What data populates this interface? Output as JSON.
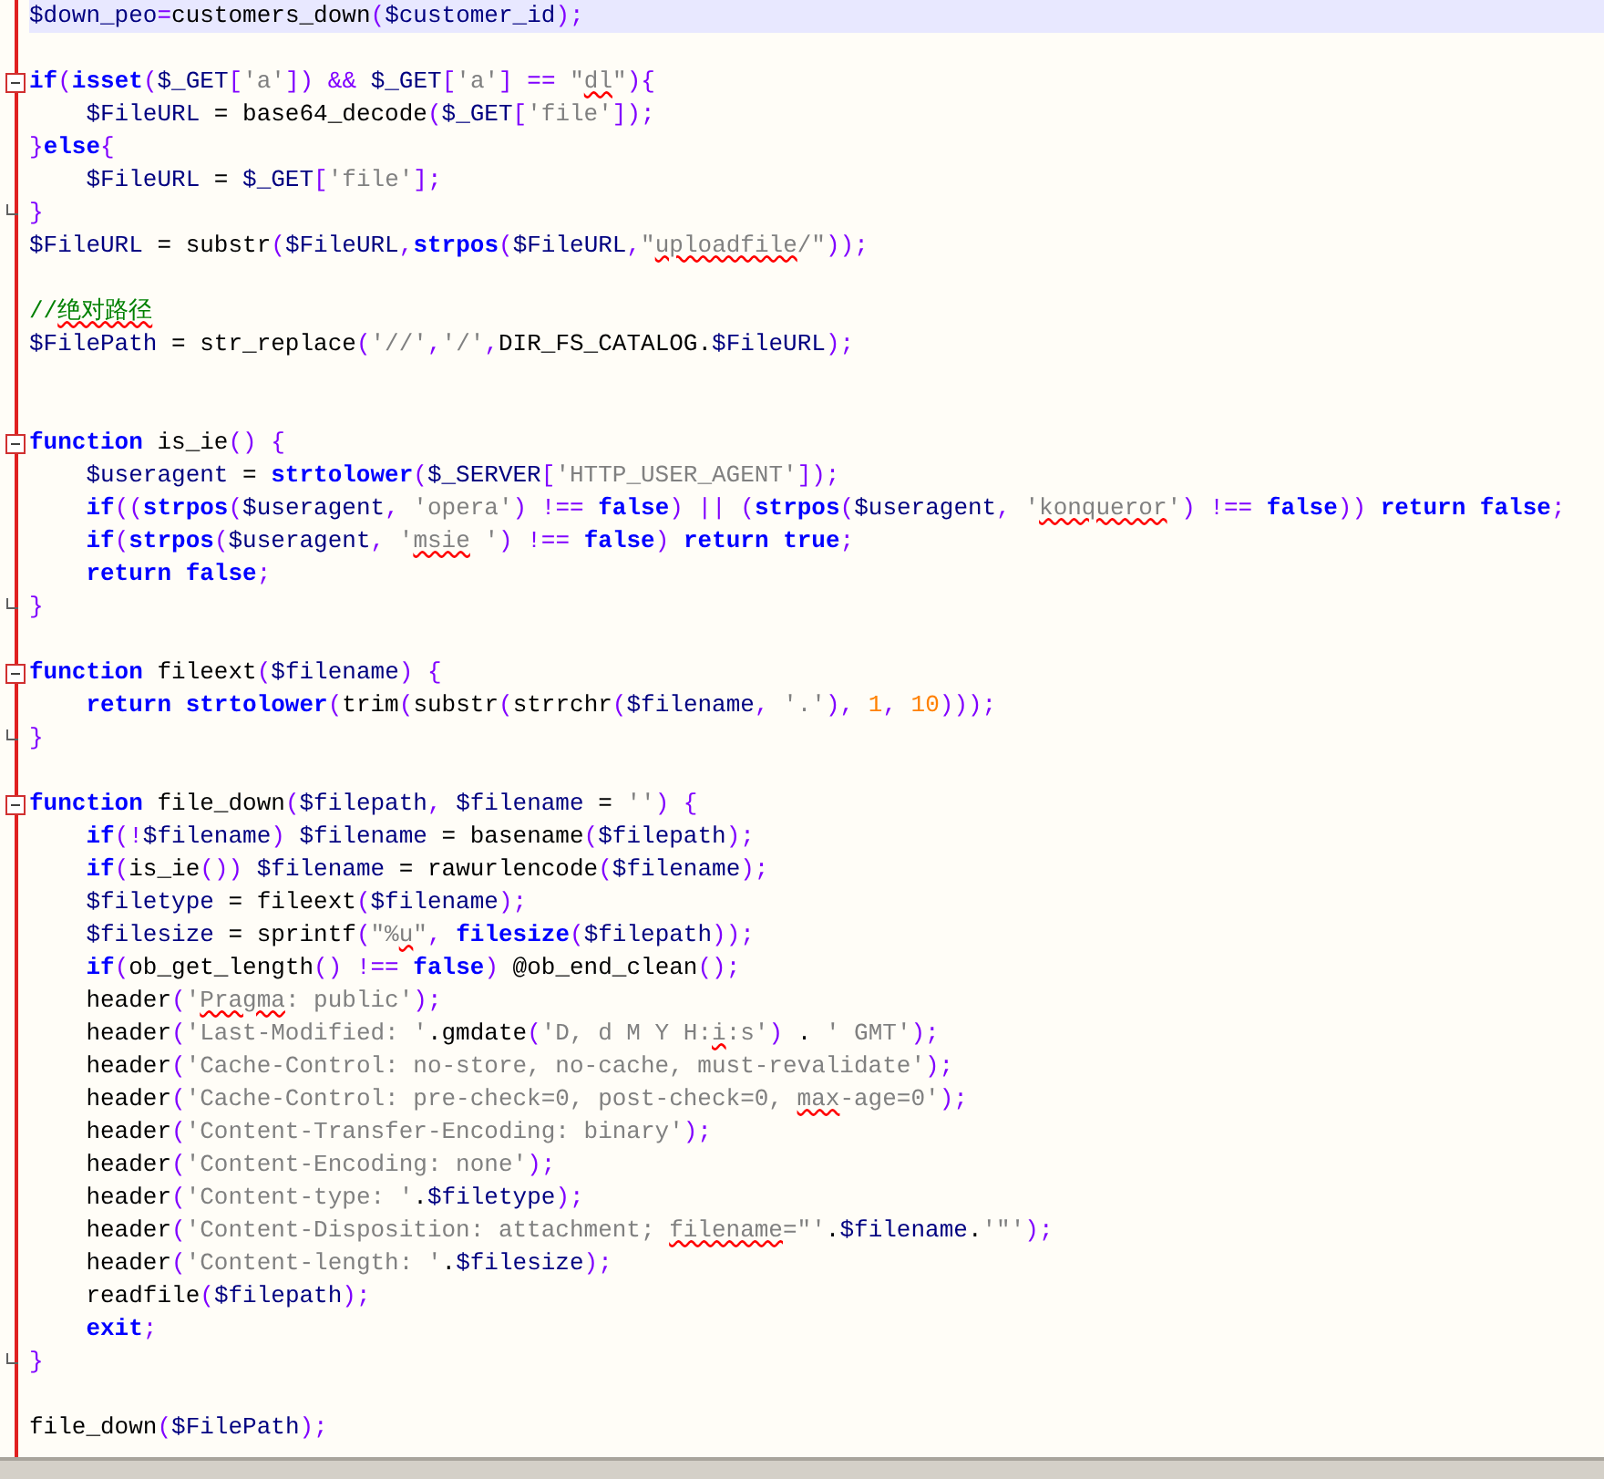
{
  "editor": {
    "lines": [
      {
        "kind": "code",
        "highlighted": true,
        "tokens": [
          {
            "kind": "var",
            "text": "$down_peo"
          },
          {
            "kind": "op",
            "text": "="
          },
          {
            "kind": "plain",
            "text": "customers_down"
          },
          {
            "kind": "punct",
            "text": "("
          },
          {
            "kind": "var",
            "text": "$customer_id"
          },
          {
            "kind": "punct",
            "text": ");"
          }
        ]
      },
      {
        "kind": "blank",
        "highlighted": false
      },
      {
        "kind": "fold-start",
        "highlighted": false,
        "tokens": [
          {
            "kind": "kw",
            "text": "if"
          },
          {
            "kind": "punct",
            "text": "("
          },
          {
            "kind": "kw",
            "text": "isset"
          },
          {
            "kind": "punct",
            "text": "("
          },
          {
            "kind": "var",
            "text": "$_GET"
          },
          {
            "kind": "punct",
            "text": "["
          },
          {
            "kind": "str",
            "text": "'a'"
          },
          {
            "kind": "punct",
            "text": "])"
          },
          {
            "kind": "op",
            "text": " && "
          },
          {
            "kind": "var",
            "text": "$_GET"
          },
          {
            "kind": "punct",
            "text": "["
          },
          {
            "kind": "str",
            "text": "'a'"
          },
          {
            "kind": "punct",
            "text": "]"
          },
          {
            "kind": "op",
            "text": " == "
          },
          {
            "kind": "str",
            "text": "\""
          },
          {
            "kind": "str-flagged",
            "text": "dl"
          },
          {
            "kind": "str",
            "text": "\""
          },
          {
            "kind": "punct",
            "text": "){"
          }
        ]
      },
      {
        "kind": "code",
        "highlighted": false,
        "tokens": [
          {
            "kind": "var",
            "text": "    $FileURL"
          },
          {
            "kind": "plain",
            "text": " = base64_decode"
          },
          {
            "kind": "punct",
            "text": "("
          },
          {
            "kind": "var",
            "text": "$_GET"
          },
          {
            "kind": "punct",
            "text": "["
          },
          {
            "kind": "str",
            "text": "'file'"
          },
          {
            "kind": "punct",
            "text": "]);"
          }
        ]
      },
      {
        "kind": "code",
        "highlighted": false,
        "tokens": [
          {
            "kind": "punct",
            "text": "}"
          },
          {
            "kind": "kw",
            "text": "else"
          },
          {
            "kind": "punct",
            "text": "{"
          }
        ]
      },
      {
        "kind": "code",
        "highlighted": false,
        "tokens": [
          {
            "kind": "var",
            "text": "    $FileURL"
          },
          {
            "kind": "plain",
            "text": " = "
          },
          {
            "kind": "var",
            "text": "$_GET"
          },
          {
            "kind": "punct",
            "text": "["
          },
          {
            "kind": "str",
            "text": "'file'"
          },
          {
            "kind": "punct",
            "text": "];"
          }
        ]
      },
      {
        "kind": "fold-end",
        "highlighted": false,
        "tokens": [
          {
            "kind": "punct",
            "text": "}"
          }
        ]
      },
      {
        "kind": "code",
        "highlighted": false,
        "tokens": [
          {
            "kind": "var",
            "text": "$FileURL"
          },
          {
            "kind": "plain",
            "text": " = substr"
          },
          {
            "kind": "punct",
            "text": "("
          },
          {
            "kind": "var",
            "text": "$FileURL"
          },
          {
            "kind": "punct",
            "text": ","
          },
          {
            "kind": "fn",
            "text": "strpos"
          },
          {
            "kind": "punct",
            "text": "("
          },
          {
            "kind": "var",
            "text": "$FileURL"
          },
          {
            "kind": "punct",
            "text": ","
          },
          {
            "kind": "str",
            "text": "\""
          },
          {
            "kind": "str-flagged",
            "text": "uploadfile"
          },
          {
            "kind": "str",
            "text": "/\""
          },
          {
            "kind": "punct",
            "text": "));"
          }
        ]
      },
      {
        "kind": "blank",
        "highlighted": false
      },
      {
        "kind": "code",
        "highlighted": false,
        "tokens": [
          {
            "kind": "comment",
            "text": "//"
          },
          {
            "kind": "comment-flagged",
            "text": "绝对路径"
          }
        ]
      },
      {
        "kind": "code",
        "highlighted": false,
        "tokens": [
          {
            "kind": "var",
            "text": "$FilePath"
          },
          {
            "kind": "plain",
            "text": " = str_replace"
          },
          {
            "kind": "punct",
            "text": "("
          },
          {
            "kind": "str",
            "text": "'//'"
          },
          {
            "kind": "punct",
            "text": ","
          },
          {
            "kind": "str",
            "text": "'/'"
          },
          {
            "kind": "punct",
            "text": ","
          },
          {
            "kind": "plain",
            "text": "DIR_FS_CATALOG."
          },
          {
            "kind": "var",
            "text": "$FileURL"
          },
          {
            "kind": "punct",
            "text": ");"
          }
        ]
      },
      {
        "kind": "blank",
        "highlighted": false
      },
      {
        "kind": "blank",
        "highlighted": false
      },
      {
        "kind": "fold-start",
        "highlighted": false,
        "tokens": [
          {
            "kind": "kw",
            "text": "function"
          },
          {
            "kind": "plain",
            "text": " is_ie"
          },
          {
            "kind": "punct",
            "text": "()"
          },
          {
            "kind": "punct",
            "text": " {"
          }
        ]
      },
      {
        "kind": "code",
        "highlighted": false,
        "tokens": [
          {
            "kind": "var",
            "text": "    $useragent"
          },
          {
            "kind": "plain",
            "text": " = "
          },
          {
            "kind": "fn",
            "text": "strtolower"
          },
          {
            "kind": "punct",
            "text": "("
          },
          {
            "kind": "var",
            "text": "$_SERVER"
          },
          {
            "kind": "punct",
            "text": "["
          },
          {
            "kind": "str",
            "text": "'HTTP_USER_AGENT'"
          },
          {
            "kind": "punct",
            "text": "]);"
          }
        ]
      },
      {
        "kind": "code",
        "highlighted": false,
        "tokens": [
          {
            "kind": "kw",
            "text": "    if"
          },
          {
            "kind": "punct",
            "text": "(("
          },
          {
            "kind": "fn",
            "text": "strpos"
          },
          {
            "kind": "punct",
            "text": "("
          },
          {
            "kind": "var",
            "text": "$useragent"
          },
          {
            "kind": "punct",
            "text": ", "
          },
          {
            "kind": "str",
            "text": "'opera'"
          },
          {
            "kind": "punct",
            "text": ")"
          },
          {
            "kind": "op",
            "text": " !== "
          },
          {
            "kind": "kw",
            "text": "false"
          },
          {
            "kind": "punct",
            "text": ")"
          },
          {
            "kind": "op",
            "text": " || "
          },
          {
            "kind": "punct",
            "text": "("
          },
          {
            "kind": "fn",
            "text": "strpos"
          },
          {
            "kind": "punct",
            "text": "("
          },
          {
            "kind": "var",
            "text": "$useragent"
          },
          {
            "kind": "punct",
            "text": ", "
          },
          {
            "kind": "str",
            "text": "'"
          },
          {
            "kind": "str-flagged",
            "text": "konqueror"
          },
          {
            "kind": "str",
            "text": "'"
          },
          {
            "kind": "punct",
            "text": ")"
          },
          {
            "kind": "op",
            "text": " !== "
          },
          {
            "kind": "kw",
            "text": "false"
          },
          {
            "kind": "punct",
            "text": "))"
          },
          {
            "kind": "kw",
            "text": " return false"
          },
          {
            "kind": "punct",
            "text": ";"
          }
        ]
      },
      {
        "kind": "code",
        "highlighted": false,
        "tokens": [
          {
            "kind": "kw",
            "text": "    if"
          },
          {
            "kind": "punct",
            "text": "("
          },
          {
            "kind": "fn",
            "text": "strpos"
          },
          {
            "kind": "punct",
            "text": "("
          },
          {
            "kind": "var",
            "text": "$useragent"
          },
          {
            "kind": "punct",
            "text": ", "
          },
          {
            "kind": "str",
            "text": "'"
          },
          {
            "kind": "str-flagged",
            "text": "msie"
          },
          {
            "kind": "str",
            "text": " '"
          },
          {
            "kind": "punct",
            "text": ")"
          },
          {
            "kind": "op",
            "text": " !== "
          },
          {
            "kind": "kw",
            "text": "false"
          },
          {
            "kind": "punct",
            "text": ")"
          },
          {
            "kind": "kw",
            "text": " return true"
          },
          {
            "kind": "punct",
            "text": ";"
          }
        ]
      },
      {
        "kind": "code",
        "highlighted": false,
        "tokens": [
          {
            "kind": "kw",
            "text": "    return false"
          },
          {
            "kind": "punct",
            "text": ";"
          }
        ]
      },
      {
        "kind": "fold-end",
        "highlighted": false,
        "tokens": [
          {
            "kind": "punct",
            "text": "}"
          }
        ]
      },
      {
        "kind": "blank",
        "highlighted": false
      },
      {
        "kind": "fold-start",
        "highlighted": false,
        "tokens": [
          {
            "kind": "kw",
            "text": "function"
          },
          {
            "kind": "plain",
            "text": " fileext"
          },
          {
            "kind": "punct",
            "text": "("
          },
          {
            "kind": "var",
            "text": "$filename"
          },
          {
            "kind": "punct",
            "text": ") {"
          }
        ]
      },
      {
        "kind": "code",
        "highlighted": false,
        "tokens": [
          {
            "kind": "kw",
            "text": "    return"
          },
          {
            "kind": "fn",
            "text": " strtolower"
          },
          {
            "kind": "punct",
            "text": "("
          },
          {
            "kind": "plain",
            "text": "trim"
          },
          {
            "kind": "punct",
            "text": "("
          },
          {
            "kind": "plain",
            "text": "substr"
          },
          {
            "kind": "punct",
            "text": "("
          },
          {
            "kind": "plain",
            "text": "strrchr"
          },
          {
            "kind": "punct",
            "text": "("
          },
          {
            "kind": "var",
            "text": "$filename"
          },
          {
            "kind": "punct",
            "text": ", "
          },
          {
            "kind": "str",
            "text": "'.'"
          },
          {
            "kind": "punct",
            "text": "),"
          },
          {
            "kind": "num",
            "text": " 1"
          },
          {
            "kind": "punct",
            "text": ","
          },
          {
            "kind": "num",
            "text": " 10"
          },
          {
            "kind": "punct",
            "text": ")));"
          }
        ]
      },
      {
        "kind": "fold-end",
        "highlighted": false,
        "tokens": [
          {
            "kind": "punct",
            "text": "}"
          }
        ]
      },
      {
        "kind": "blank",
        "highlighted": false
      },
      {
        "kind": "fold-start",
        "highlighted": false,
        "tokens": [
          {
            "kind": "kw",
            "text": "function"
          },
          {
            "kind": "plain",
            "text": " file_down"
          },
          {
            "kind": "punct",
            "text": "("
          },
          {
            "kind": "var",
            "text": "$filepath"
          },
          {
            "kind": "punct",
            "text": ", "
          },
          {
            "kind": "var",
            "text": "$filename"
          },
          {
            "kind": "plain",
            "text": " = "
          },
          {
            "kind": "str",
            "text": "''"
          },
          {
            "kind": "punct",
            "text": ") {"
          }
        ]
      },
      {
        "kind": "code",
        "highlighted": false,
        "tokens": [
          {
            "kind": "kw",
            "text": "    if"
          },
          {
            "kind": "punct",
            "text": "(!"
          },
          {
            "kind": "var",
            "text": "$filename"
          },
          {
            "kind": "punct",
            "text": ")"
          },
          {
            "kind": "var",
            "text": " $filename"
          },
          {
            "kind": "plain",
            "text": " = basename"
          },
          {
            "kind": "punct",
            "text": "("
          },
          {
            "kind": "var",
            "text": "$filepath"
          },
          {
            "kind": "punct",
            "text": ");"
          }
        ]
      },
      {
        "kind": "code",
        "highlighted": false,
        "tokens": [
          {
            "kind": "kw",
            "text": "    if"
          },
          {
            "kind": "punct",
            "text": "("
          },
          {
            "kind": "plain",
            "text": "is_ie"
          },
          {
            "kind": "punct",
            "text": "())"
          },
          {
            "kind": "var",
            "text": " $filename"
          },
          {
            "kind": "plain",
            "text": " = rawurlencode"
          },
          {
            "kind": "punct",
            "text": "("
          },
          {
            "kind": "var",
            "text": "$filename"
          },
          {
            "kind": "punct",
            "text": ");"
          }
        ]
      },
      {
        "kind": "code",
        "highlighted": false,
        "tokens": [
          {
            "kind": "var",
            "text": "    $filetype"
          },
          {
            "kind": "plain",
            "text": " = fileext"
          },
          {
            "kind": "punct",
            "text": "("
          },
          {
            "kind": "var",
            "text": "$filename"
          },
          {
            "kind": "punct",
            "text": ");"
          }
        ]
      },
      {
        "kind": "code",
        "highlighted": false,
        "tokens": [
          {
            "kind": "var",
            "text": "    $filesize"
          },
          {
            "kind": "plain",
            "text": " = sprintf"
          },
          {
            "kind": "punct",
            "text": "("
          },
          {
            "kind": "str",
            "text": "\"%"
          },
          {
            "kind": "str-flagged",
            "text": "u"
          },
          {
            "kind": "str",
            "text": "\""
          },
          {
            "kind": "punct",
            "text": ","
          },
          {
            "kind": "fn",
            "text": " filesize"
          },
          {
            "kind": "punct",
            "text": "("
          },
          {
            "kind": "var",
            "text": "$filepath"
          },
          {
            "kind": "punct",
            "text": "));"
          }
        ]
      },
      {
        "kind": "code",
        "highlighted": false,
        "tokens": [
          {
            "kind": "kw",
            "text": "    if"
          },
          {
            "kind": "punct",
            "text": "("
          },
          {
            "kind": "plain",
            "text": "ob_get_length"
          },
          {
            "kind": "punct",
            "text": "()"
          },
          {
            "kind": "op",
            "text": " !== "
          },
          {
            "kind": "kw",
            "text": "false"
          },
          {
            "kind": "punct",
            "text": ")"
          },
          {
            "kind": "plain",
            "text": " @ob_end_clean"
          },
          {
            "kind": "punct",
            "text": "();"
          }
        ]
      },
      {
        "kind": "code",
        "highlighted": false,
        "tokens": [
          {
            "kind": "plain",
            "text": "    header"
          },
          {
            "kind": "punct",
            "text": "("
          },
          {
            "kind": "str",
            "text": "'"
          },
          {
            "kind": "str-flagged",
            "text": "Pragma"
          },
          {
            "kind": "str",
            "text": ": public'"
          },
          {
            "kind": "punct",
            "text": ");"
          }
        ]
      },
      {
        "kind": "code",
        "highlighted": false,
        "tokens": [
          {
            "kind": "plain",
            "text": "    header"
          },
          {
            "kind": "punct",
            "text": "("
          },
          {
            "kind": "str",
            "text": "'Last-Modified: '"
          },
          {
            "kind": "plain",
            "text": ".gmdate"
          },
          {
            "kind": "punct",
            "text": "("
          },
          {
            "kind": "str",
            "text": "'D, d M Y H:"
          },
          {
            "kind": "str-flagged",
            "text": "i"
          },
          {
            "kind": "str",
            "text": ":s'"
          },
          {
            "kind": "punct",
            "text": ")"
          },
          {
            "kind": "plain",
            "text": " . "
          },
          {
            "kind": "str",
            "text": "' GMT'"
          },
          {
            "kind": "punct",
            "text": ");"
          }
        ]
      },
      {
        "kind": "code",
        "highlighted": false,
        "tokens": [
          {
            "kind": "plain",
            "text": "    header"
          },
          {
            "kind": "punct",
            "text": "("
          },
          {
            "kind": "str",
            "text": "'Cache-Control: no-store, no-cache, must-revalidate'"
          },
          {
            "kind": "punct",
            "text": ");"
          }
        ]
      },
      {
        "kind": "code",
        "highlighted": false,
        "tokens": [
          {
            "kind": "plain",
            "text": "    header"
          },
          {
            "kind": "punct",
            "text": "("
          },
          {
            "kind": "str",
            "text": "'Cache-Control: pre-check=0, post-check=0, "
          },
          {
            "kind": "str-flagged",
            "text": "max"
          },
          {
            "kind": "str",
            "text": "-age=0'"
          },
          {
            "kind": "punct",
            "text": ");"
          }
        ]
      },
      {
        "kind": "code",
        "highlighted": false,
        "tokens": [
          {
            "kind": "plain",
            "text": "    header"
          },
          {
            "kind": "punct",
            "text": "("
          },
          {
            "kind": "str",
            "text": "'Content-Transfer-Encoding: binary'"
          },
          {
            "kind": "punct",
            "text": ");"
          }
        ]
      },
      {
        "kind": "code",
        "highlighted": false,
        "tokens": [
          {
            "kind": "plain",
            "text": "    header"
          },
          {
            "kind": "punct",
            "text": "("
          },
          {
            "kind": "str",
            "text": "'Content-Encoding: none'"
          },
          {
            "kind": "punct",
            "text": ");"
          }
        ]
      },
      {
        "kind": "code",
        "highlighted": false,
        "tokens": [
          {
            "kind": "plain",
            "text": "    header"
          },
          {
            "kind": "punct",
            "text": "("
          },
          {
            "kind": "str",
            "text": "'Content-type: '"
          },
          {
            "kind": "plain",
            "text": "."
          },
          {
            "kind": "var",
            "text": "$filetype"
          },
          {
            "kind": "punct",
            "text": ");"
          }
        ]
      },
      {
        "kind": "code",
        "highlighted": false,
        "tokens": [
          {
            "kind": "plain",
            "text": "    header"
          },
          {
            "kind": "punct",
            "text": "("
          },
          {
            "kind": "str",
            "text": "'Content-Disposition: attachment; "
          },
          {
            "kind": "str-flagged",
            "text": "filename"
          },
          {
            "kind": "str",
            "text": "=\"'"
          },
          {
            "kind": "plain",
            "text": "."
          },
          {
            "kind": "var",
            "text": "$filename"
          },
          {
            "kind": "plain",
            "text": "."
          },
          {
            "kind": "str",
            "text": "'\"'"
          },
          {
            "kind": "punct",
            "text": ");"
          }
        ]
      },
      {
        "kind": "code",
        "highlighted": false,
        "tokens": [
          {
            "kind": "plain",
            "text": "    header"
          },
          {
            "kind": "punct",
            "text": "("
          },
          {
            "kind": "str",
            "text": "'Content-length: '"
          },
          {
            "kind": "plain",
            "text": "."
          },
          {
            "kind": "var",
            "text": "$filesize"
          },
          {
            "kind": "punct",
            "text": ");"
          }
        ]
      },
      {
        "kind": "code",
        "highlighted": false,
        "tokens": [
          {
            "kind": "plain",
            "text": "    readfile"
          },
          {
            "kind": "punct",
            "text": "("
          },
          {
            "kind": "var",
            "text": "$filepath"
          },
          {
            "kind": "punct",
            "text": ");"
          }
        ]
      },
      {
        "kind": "code",
        "highlighted": false,
        "tokens": [
          {
            "kind": "kw",
            "text": "    exit"
          },
          {
            "kind": "punct",
            "text": ";"
          }
        ]
      },
      {
        "kind": "fold-end",
        "highlighted": false,
        "tokens": [
          {
            "kind": "punct",
            "text": "}"
          }
        ]
      },
      {
        "kind": "blank",
        "highlighted": false
      },
      {
        "kind": "code",
        "highlighted": false,
        "tokens": [
          {
            "kind": "plain",
            "text": "file_down"
          },
          {
            "kind": "punct",
            "text": "("
          },
          {
            "kind": "var",
            "text": "$FilePath"
          },
          {
            "kind": "punct",
            "text": ");"
          }
        ]
      }
    ]
  }
}
